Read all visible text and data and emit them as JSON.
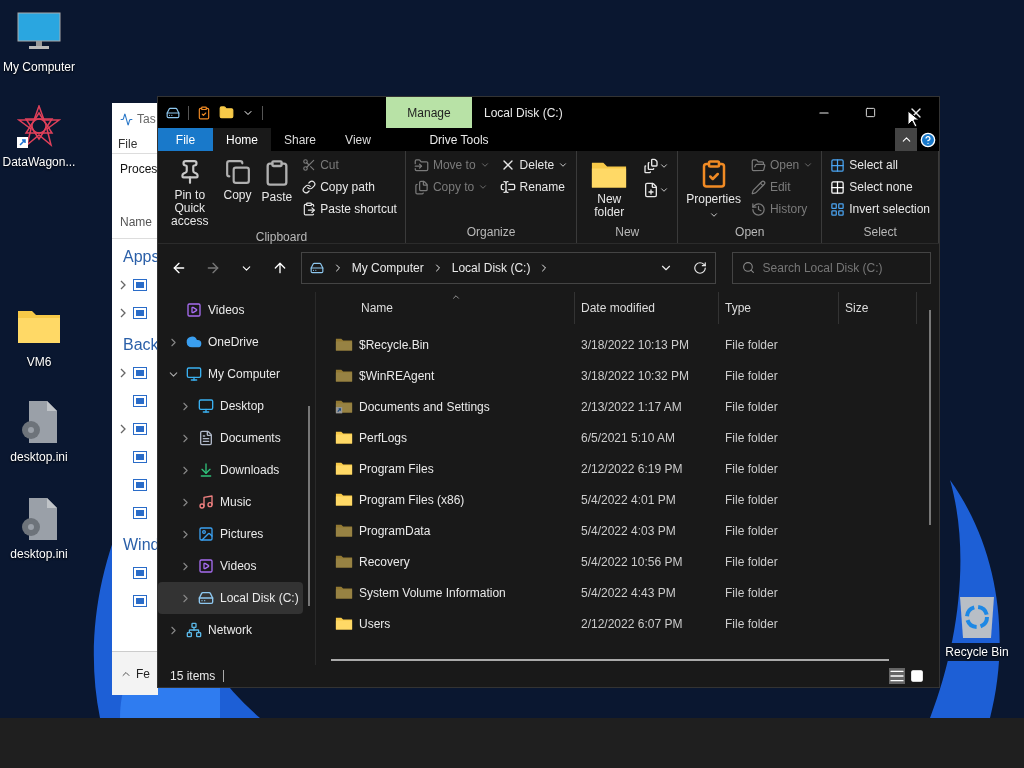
{
  "desktop": {
    "icons": [
      {
        "label": "My Computer",
        "shortcut": false
      },
      {
        "label": "DataWagon...",
        "shortcut": true
      },
      {
        "label": "VM6",
        "shortcut": false
      },
      {
        "label": "desktop.ini",
        "shortcut": false
      },
      {
        "label": "desktop.ini",
        "shortcut": false
      },
      {
        "label": "Recycle Bin",
        "shortcut": false
      }
    ]
  },
  "background_window": {
    "title": "Tas",
    "menu": "File",
    "tab": "Proces",
    "column": "Name",
    "footer": "Fe",
    "sections": [
      {
        "label": "Apps",
        "rows": [
          {
            "expandable": true
          },
          {
            "expandable": true
          }
        ]
      },
      {
        "label": "Back",
        "rows": [
          {
            "expandable": true
          },
          {
            "expandable": false
          },
          {
            "expandable": true
          },
          {
            "expandable": false
          },
          {
            "expandable": false
          },
          {
            "expandable": false
          }
        ]
      },
      {
        "label": "Wind",
        "rows": [
          {
            "expandable": false
          },
          {
            "expandable": false
          }
        ]
      }
    ]
  },
  "explorer": {
    "title": "Local Disk (C:)",
    "context_tab": "Manage",
    "ribbon_tabs": [
      {
        "label": "File",
        "kind": "file",
        "selected": false
      },
      {
        "label": "Home",
        "kind": "tab",
        "selected": true
      },
      {
        "label": "Share",
        "kind": "tab",
        "selected": false
      },
      {
        "label": "View",
        "kind": "tab",
        "selected": false
      },
      {
        "label": "Drive Tools",
        "kind": "context",
        "selected": false
      }
    ],
    "ribbon_groups": [
      {
        "label": "Clipboard",
        "columns": [
          [
            {
              "label": "Pin to Quick access",
              "kind": "large",
              "disabled": false
            }
          ],
          [
            {
              "label": "Copy",
              "kind": "large",
              "disabled": false
            }
          ],
          [
            {
              "label": "Paste",
              "kind": "large",
              "disabled": false
            }
          ],
          [
            {
              "label": "Cut",
              "kind": "small",
              "disabled": true
            },
            {
              "label": "Copy path",
              "kind": "small",
              "disabled": false
            },
            {
              "label": "Paste shortcut",
              "kind": "small",
              "disabled": false
            }
          ]
        ]
      },
      {
        "label": "Organize",
        "columns": [
          [
            {
              "label": "Move to",
              "kind": "small",
              "disabled": true,
              "dropdown": true
            },
            {
              "label": "Copy to",
              "kind": "small",
              "disabled": true,
              "dropdown": true
            }
          ],
          [
            {
              "label": "Delete",
              "kind": "small",
              "disabled": false,
              "dropdown": true
            },
            {
              "label": "Rename",
              "kind": "small",
              "disabled": false
            }
          ]
        ]
      },
      {
        "label": "New",
        "columns": [
          [
            {
              "label": "New folder",
              "kind": "large",
              "disabled": false
            }
          ],
          [
            {
              "kind": "icon",
              "disabled": false,
              "dropdown": true
            },
            {
              "kind": "icon",
              "disabled": false,
              "dropdown": true
            }
          ]
        ]
      },
      {
        "label": "Open",
        "columns": [
          [
            {
              "label": "Properties",
              "kind": "large",
              "disabled": false,
              "dropdown": true
            }
          ],
          [
            {
              "label": "Open",
              "kind": "small",
              "disabled": true,
              "dropdown": true
            },
            {
              "label": "Edit",
              "kind": "small",
              "disabled": true
            },
            {
              "label": "History",
              "kind": "small",
              "disabled": true
            }
          ]
        ]
      },
      {
        "label": "Select",
        "columns": [
          [
            {
              "label": "Select all",
              "kind": "small",
              "disabled": false
            },
            {
              "label": "Select none",
              "kind": "small",
              "disabled": false
            },
            {
              "label": "Invert selection",
              "kind": "small",
              "disabled": false
            }
          ]
        ]
      }
    ],
    "nav_buttons": [
      {
        "disabled": false
      },
      {
        "disabled": true
      },
      {
        "disabled": false
      },
      {
        "disabled": false
      }
    ],
    "breadcrumbs": [
      "My Computer",
      "Local Disk (C:)"
    ],
    "search": {
      "placeholder": "Search Local Disk (C:)"
    },
    "tree": [
      {
        "label": "Videos",
        "selected": false
      },
      {
        "label": "OneDrive",
        "expanded": false,
        "selected": false
      },
      {
        "label": "My Computer",
        "expanded": true,
        "selected": false,
        "children": [
          {
            "label": "Desktop",
            "expanded": false,
            "selected": false
          },
          {
            "label": "Documents",
            "expanded": false,
            "selected": false
          },
          {
            "label": "Downloads",
            "expanded": false,
            "selected": false
          },
          {
            "label": "Music",
            "expanded": false,
            "selected": false
          },
          {
            "label": "Pictures",
            "expanded": false,
            "selected": false
          },
          {
            "label": "Videos",
            "expanded": false,
            "selected": false
          },
          {
            "label": "Local Disk (C:)",
            "expanded": false,
            "selected": true
          }
        ]
      },
      {
        "label": "Network",
        "expanded": false,
        "selected": false
      }
    ],
    "columns": [
      "Name",
      "Date modified",
      "Type",
      "Size"
    ],
    "rows": [
      {
        "name": "$Recycle.Bin",
        "date": "3/18/2022 10:13 PM",
        "type": "File folder",
        "hidden": true,
        "shortcut": false
      },
      {
        "name": "$WinREAgent",
        "date": "3/18/2022 10:32 PM",
        "type": "File folder",
        "hidden": true,
        "shortcut": false
      },
      {
        "name": "Documents and Settings",
        "date": "2/13/2022 1:17 AM",
        "type": "File folder",
        "hidden": true,
        "shortcut": true
      },
      {
        "name": "PerfLogs",
        "date": "6/5/2021 5:10 AM",
        "type": "File folder",
        "hidden": false,
        "shortcut": false
      },
      {
        "name": "Program Files",
        "date": "2/12/2022 6:19 PM",
        "type": "File folder",
        "hidden": false,
        "shortcut": false
      },
      {
        "name": "Program Files (x86)",
        "date": "5/4/2022 4:01 PM",
        "type": "File folder",
        "hidden": false,
        "shortcut": false
      },
      {
        "name": "ProgramData",
        "date": "5/4/2022 4:03 PM",
        "type": "File folder",
        "hidden": true,
        "shortcut": false
      },
      {
        "name": "Recovery",
        "date": "5/4/2022 10:56 PM",
        "type": "File folder",
        "hidden": true,
        "shortcut": false
      },
      {
        "name": "System Volume Information",
        "date": "5/4/2022 4:43 PM",
        "type": "File folder",
        "hidden": true,
        "shortcut": false
      },
      {
        "name": "Users",
        "date": "2/12/2022 6:07 PM",
        "type": "File folder",
        "hidden": false,
        "shortcut": false
      }
    ],
    "status": "15 items",
    "views": [
      {
        "selected": true
      },
      {
        "selected": false
      }
    ]
  }
}
